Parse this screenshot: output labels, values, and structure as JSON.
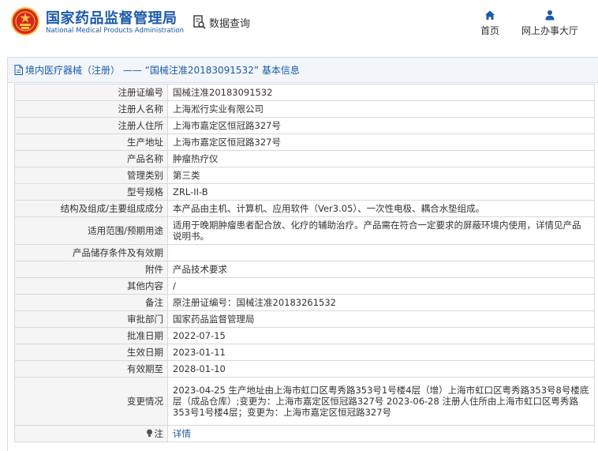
{
  "header": {
    "brand_cn": "国家药品监督管理局",
    "brand_en": "National Medical Products Administration",
    "query_label": "数据查询",
    "nav": [
      {
        "label": "首页",
        "icon": "home-icon"
      },
      {
        "label": "网上办事大厅",
        "icon": "user-icon"
      }
    ]
  },
  "panel": {
    "title": "境内医疗器械（注册） —— “国械注准20183091532” 基本信息"
  },
  "rows": [
    {
      "key": "注册证编号",
      "value": "国械注准20183091532"
    },
    {
      "key": "注册人名称",
      "value": "上海淞行实业有限公司"
    },
    {
      "key": "注册人住所",
      "value": "上海市嘉定区恒冠路327号"
    },
    {
      "key": "生产地址",
      "value": "上海市嘉定区恒冠路327号"
    },
    {
      "key": "产品名称",
      "value": "肿瘤热疗仪"
    },
    {
      "key": "管理类别",
      "value": "第三类"
    },
    {
      "key": "型号规格",
      "value": "ZRL-II-B"
    },
    {
      "key": "结构及组成/主要组成成分",
      "value": "本产品由主机、计算机、应用软件（Ver3.05）、一次性电极、耦合水垫组成。"
    },
    {
      "key": "适用范围/预期用途",
      "value": "适用于晚期肿瘤患者配合放、化疗的辅助治疗。产品需在符合一定要求的屏蔽环境内使用，详情见产品说明书。"
    },
    {
      "key": "产品储存条件及有效期",
      "value": ""
    },
    {
      "key": "附件",
      "value": "产品技术要求"
    },
    {
      "key": "其他内容",
      "value": "/"
    },
    {
      "key": "备注",
      "value": "原注册证编号：国械注准20183261532"
    },
    {
      "key": "审批部门",
      "value": "国家药品监督管理局"
    },
    {
      "key": "批准日期",
      "value": "2022-07-15"
    },
    {
      "key": "生效日期",
      "value": "2023-01-11"
    },
    {
      "key": "有效期至",
      "value": "2028-01-10"
    },
    {
      "key": "变更情况",
      "value": "2023-04-25 生产地址由上海市虹口区粤秀路353号1号楼4层（增）上海市虹口区粤秀路353号8号楼底层（成品仓库）;变更为：上海市嘉定区恒冠路327号 2023-06-28 注册人住所由上海市虹口区粤秀路353号1号楼4层；变更为：上海市嘉定区恒冠路327号"
    }
  ],
  "note": {
    "key": "注",
    "value": "详情"
  },
  "colors": {
    "brand_blue": "#1b5aa9",
    "emblem_red": "#d7261e",
    "emblem_gold": "#f4c542"
  }
}
